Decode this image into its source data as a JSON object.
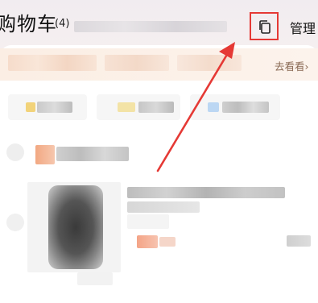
{
  "header": {
    "title": "购物车",
    "count": "(4)",
    "manage_label": "管理"
  },
  "promo": {
    "link_text": "去看看",
    "link_chevron": "›"
  },
  "icons": {
    "copy": "copy-icon"
  },
  "colors": {
    "annotation_red": "#e53935",
    "promo_text": "#8a6a55"
  }
}
